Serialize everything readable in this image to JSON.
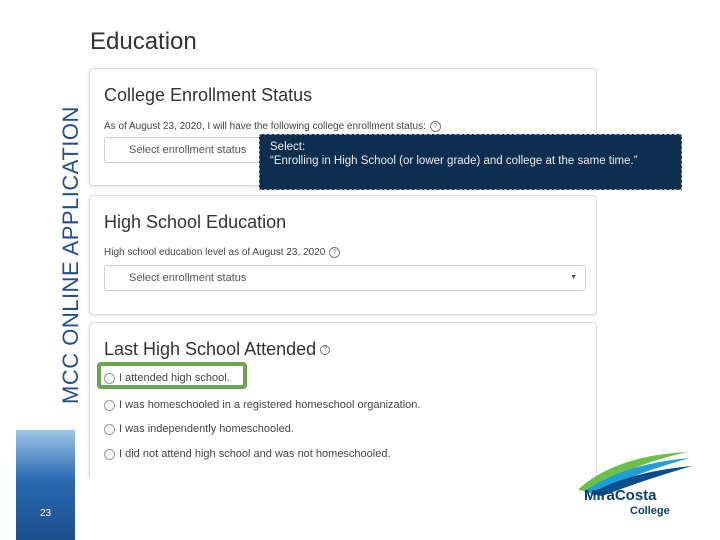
{
  "slide": {
    "side_title": "MCC ONLINE APPLICATION",
    "page_number": "23"
  },
  "screenshot": {
    "page_title": "Education",
    "enrollment_card": {
      "title": "College Enrollment Status",
      "label": "As of August 23, 2020, I will have the following college enrollment status:",
      "select_value": "Select enrollment status"
    },
    "high_school_card": {
      "title": "High School Education",
      "label": "High school education level as of August 23, 2020",
      "select_value": "Select enrollment status"
    },
    "last_school_card": {
      "title": "Last High School Attended",
      "options": [
        "I attended high school.",
        "I was homeschooled in a registered homeschool organization.",
        "I was independently homeschooled.",
        "I did not attend high school and was not homeschooled."
      ]
    }
  },
  "callout": {
    "line1": "Select:",
    "line2": "“Enrolling in High School (or lower grade) and college at the same time.”"
  },
  "logo": {
    "line1": "MiraCosta",
    "line2": "College"
  },
  "colors": {
    "side_title": "#1f4e8c",
    "callout_bg": "#0d2e4e",
    "highlight": "#6aa84f"
  }
}
